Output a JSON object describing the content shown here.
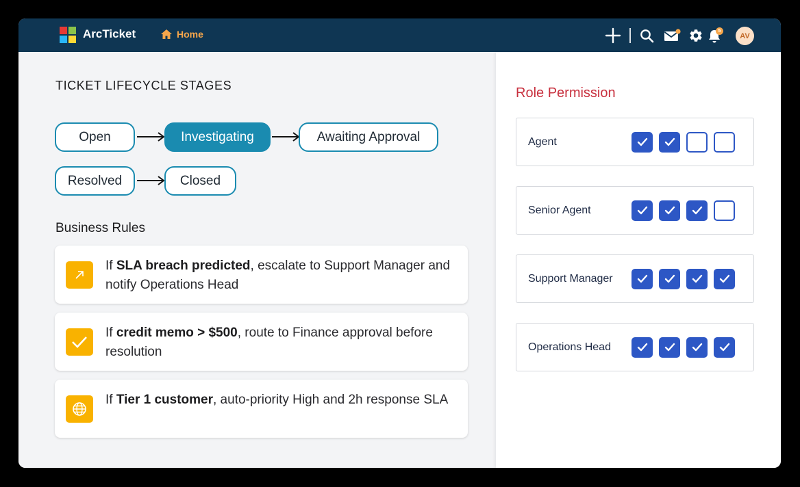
{
  "header": {
    "brand": "ArcTicket",
    "home_label": "Home",
    "notification_count": "5",
    "avatar_initials": "AV"
  },
  "icons": {
    "logo": "arcticket-logo-icon",
    "home": "home-icon",
    "add": "plus-icon",
    "search": "search-icon",
    "mail": "mail-icon",
    "settings": "gear-icon",
    "notifications": "bell-icon"
  },
  "lifecycle": {
    "title": "TICKET LIFECYCLE STAGES",
    "stages": [
      {
        "label": "Open",
        "active": false
      },
      {
        "label": "Investigating",
        "active": true
      },
      {
        "label": "Awaiting Approval",
        "active": false
      },
      {
        "label": "Resolved",
        "active": false
      },
      {
        "label": "Closed",
        "active": false
      }
    ]
  },
  "business_rules": {
    "title": "Business Rules",
    "rules": [
      {
        "icon": "arrow-up-right-icon",
        "prefix": "If ",
        "bold": "SLA breach predicted",
        "rest": ", escalate to Support Manager and notify Operations Head"
      },
      {
        "icon": "checkmark-icon",
        "prefix": "If ",
        "bold": "credit memo > $500",
        "rest": ", route to Finance approval before resolution"
      },
      {
        "icon": "globe-icon",
        "prefix": "If ",
        "bold": "Tier 1 customer",
        "rest": ", auto-priority High and 2h response SLA"
      }
    ]
  },
  "role_permission": {
    "title": "Role Permission",
    "roles": [
      {
        "name": "Agent",
        "permissions": [
          true,
          true,
          false,
          false
        ]
      },
      {
        "name": "Senior Agent",
        "permissions": [
          true,
          true,
          true,
          false
        ]
      },
      {
        "name": "Support Manager",
        "permissions": [
          true,
          true,
          true,
          true
        ]
      },
      {
        "name": "Operations Head",
        "permissions": [
          true,
          true,
          true,
          true
        ]
      }
    ]
  },
  "colors": {
    "topbar": "#0f3653",
    "accent_orange": "#f5a64b",
    "stage_border": "#1a8bb0",
    "rule_icon_bg": "#f9b200",
    "checkbox_blue": "#2d57c5",
    "permission_title": "#c8313f"
  }
}
